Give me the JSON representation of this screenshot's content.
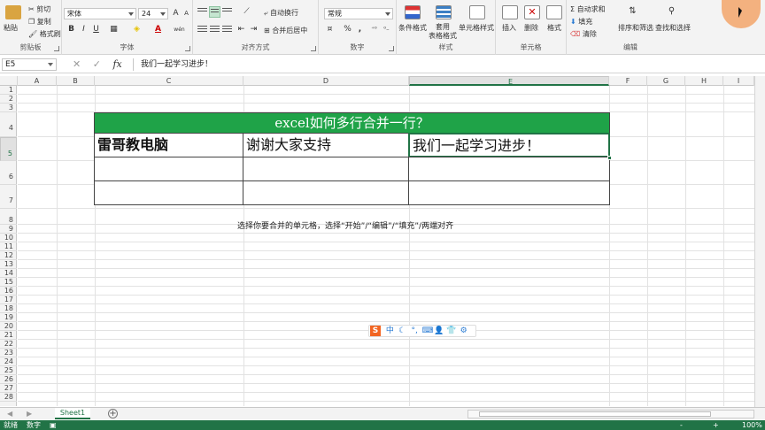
{
  "ribbon": {
    "clipboard": {
      "paste": "粘贴",
      "cut": "剪切",
      "copy": "复制",
      "format_painter": "格式刷",
      "group": "剪贴板"
    },
    "font": {
      "name": "宋体",
      "size": "24",
      "bold": "B",
      "italic": "I",
      "underline": "U",
      "grow": "A",
      "shrink": "A",
      "wen": "wén",
      "group": "字体"
    },
    "alignment": {
      "wrap": "自动换行",
      "merge": "合并后居中",
      "group": "对齐方式"
    },
    "number": {
      "format": "常规",
      "percent": "%",
      "comma": ",",
      "group": "数字"
    },
    "styles": {
      "conditional": "条件格式",
      "table": "套用\n表格格式",
      "cell": "单元格样式",
      "group": "样式"
    },
    "cells": {
      "insert": "插入",
      "delete": "删除",
      "format": "格式",
      "group": "单元格"
    },
    "editing": {
      "autosum": "自动求和",
      "fill": "填充",
      "clear": "清除",
      "sort": "排序和筛选",
      "find": "查找和选择",
      "group": "编辑"
    }
  },
  "formula_bar": {
    "name_box": "E5",
    "cancel": "✕",
    "enter": "✓",
    "fx": "fx",
    "content": "我们一起学习进步！"
  },
  "columns": [
    "A",
    "B",
    "C",
    "D",
    "E",
    "F",
    "G",
    "H",
    "I"
  ],
  "selected_column": "E",
  "rows": [
    "1",
    "2",
    "3",
    "4",
    "5",
    "6",
    "7",
    "8",
    "9",
    "10",
    "11",
    "12",
    "13",
    "14",
    "15",
    "16",
    "17",
    "18",
    "19",
    "20",
    "21",
    "22",
    "23",
    "24",
    "25",
    "26",
    "27",
    "28"
  ],
  "selected_row": "5",
  "table": {
    "title": "excel如何多行合并一行？",
    "c5": "雷哥教电脑",
    "d5": "谢谢大家支持",
    "e5": "我们一起学习进步！"
  },
  "instruction": "选择你要合并的单元格，选择“开始”/“编辑”/“填充”/两端对齐",
  "ime": {
    "logo": "S",
    "lang": "中"
  },
  "sheet_tab": "Sheet1",
  "add_sheet": "+",
  "status": {
    "ready": "就绪",
    "mode": "数字",
    "zoom_minus": "-",
    "zoom_plus": "+",
    "zoom": "100%"
  },
  "colors": {
    "accent": "#217346",
    "title_fill": "#1fa348"
  }
}
